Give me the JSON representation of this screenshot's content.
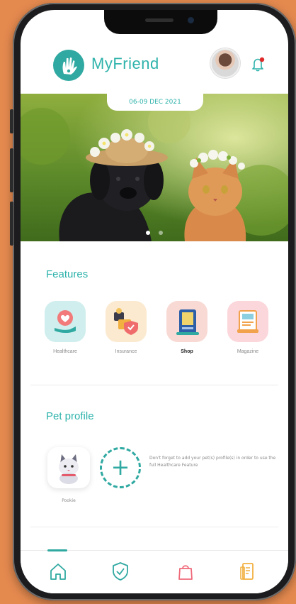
{
  "app": {
    "title": "MyFriend"
  },
  "banner": {
    "date": "06-09 DEC 2021",
    "slide_index": 1,
    "slide_count": 2
  },
  "features": {
    "title": "Features",
    "items": [
      {
        "label": "Healthcare",
        "icon": "healthcare-icon"
      },
      {
        "label": "Insurance",
        "icon": "insurance-icon"
      },
      {
        "label": "Shop",
        "icon": "shop-icon"
      },
      {
        "label": "Magazine",
        "icon": "magazine-icon"
      }
    ]
  },
  "pet_profile": {
    "title": "Pet profile",
    "pets": [
      {
        "name": "Pookie"
      }
    ],
    "add_symbol": "+",
    "hint": "Don't forget to add your pet(s) profile(s) in order to use the full Healthcare Feature"
  },
  "nav": {
    "items": [
      {
        "name": "home",
        "icon": "home-icon",
        "active": true
      },
      {
        "name": "insurance",
        "icon": "shield-check-icon",
        "active": false
      },
      {
        "name": "shop",
        "icon": "shopping-bag-icon",
        "active": false
      },
      {
        "name": "magazine",
        "icon": "magazine-icon",
        "active": false
      }
    ]
  },
  "colors": {
    "accent": "#2fb3ab",
    "background": "#e58a4f",
    "notification": "#e02a2a"
  }
}
